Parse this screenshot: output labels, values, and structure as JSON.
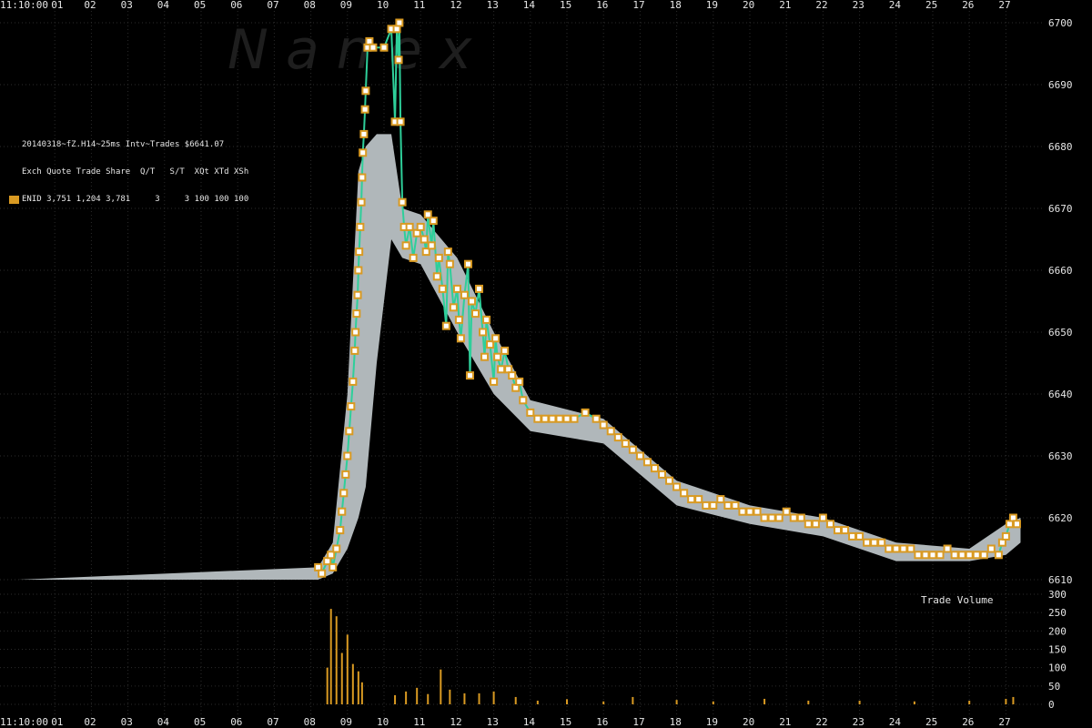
{
  "chart_data": {
    "type": "scatter",
    "watermark": "N a n e x",
    "time_label": "11:10:00",
    "x_ticks": [
      "01",
      "02",
      "03",
      "04",
      "05",
      "06",
      "07",
      "08",
      "09",
      "10",
      "11",
      "12",
      "13",
      "14",
      "15",
      "16",
      "17",
      "18",
      "19",
      "20",
      "21",
      "22",
      "23",
      "24",
      "25",
      "26",
      "27"
    ],
    "x_range_seconds": [
      0,
      28
    ],
    "price_axis": {
      "ticks": [
        "6700",
        "6690",
        "6680",
        "6670",
        "6660",
        "6650",
        "6640",
        "6630",
        "6620",
        "6610"
      ],
      "range": [
        6610,
        6700
      ]
    },
    "volume_axis": {
      "label": "Trade Volume",
      "ticks": [
        "300",
        "250",
        "200",
        "150",
        "100",
        "50",
        "0"
      ],
      "range": [
        0,
        300
      ]
    },
    "info": {
      "title": "20140318~fZ.H14~25ms Intv~Trades $6641.07",
      "header": "Exch Quote Trade Share  Q/T   S/T  XQt XTd XSh",
      "row": "ENID 3,751 1,204 3,781     3     3 100 100 100"
    },
    "colors": {
      "trade": "#d99a22",
      "quote_band": "#b0b7ba",
      "line": "#2ecf9a",
      "volume": "#d99a22"
    },
    "trades": [
      [
        8.2,
        6612
      ],
      [
        8.3,
        6611
      ],
      [
        8.45,
        6613
      ],
      [
        8.55,
        6614
      ],
      [
        8.6,
        6612
      ],
      [
        8.7,
        6615
      ],
      [
        8.8,
        6618
      ],
      [
        8.85,
        6621
      ],
      [
        8.9,
        6624
      ],
      [
        8.95,
        6627
      ],
      [
        9.0,
        6630
      ],
      [
        9.05,
        6634
      ],
      [
        9.1,
        6638
      ],
      [
        9.15,
        6642
      ],
      [
        9.2,
        6647
      ],
      [
        9.22,
        6650
      ],
      [
        9.25,
        6653
      ],
      [
        9.28,
        6656
      ],
      [
        9.3,
        6660
      ],
      [
        9.32,
        6663
      ],
      [
        9.35,
        6667
      ],
      [
        9.38,
        6671
      ],
      [
        9.4,
        6675
      ],
      [
        9.42,
        6679
      ],
      [
        9.45,
        6682
      ],
      [
        9.48,
        6686
      ],
      [
        9.5,
        6689
      ],
      [
        9.55,
        6696
      ],
      [
        9.6,
        6697
      ],
      [
        9.7,
        6696
      ],
      [
        10.0,
        6696
      ],
      [
        10.2,
        6699
      ],
      [
        10.3,
        6684
      ],
      [
        10.35,
        6699
      ],
      [
        10.4,
        6694
      ],
      [
        10.42,
        6700
      ],
      [
        10.45,
        6684
      ],
      [
        10.5,
        6671
      ],
      [
        10.55,
        6667
      ],
      [
        10.6,
        6664
      ],
      [
        10.7,
        6667
      ],
      [
        10.8,
        6662
      ],
      [
        10.9,
        6666
      ],
      [
        11.0,
        6667
      ],
      [
        11.1,
        6665
      ],
      [
        11.15,
        6663
      ],
      [
        11.2,
        6669
      ],
      [
        11.3,
        6664
      ],
      [
        11.35,
        6668
      ],
      [
        11.45,
        6659
      ],
      [
        11.5,
        6662
      ],
      [
        11.6,
        6657
      ],
      [
        11.7,
        6651
      ],
      [
        11.75,
        6663
      ],
      [
        11.8,
        6661
      ],
      [
        11.9,
        6654
      ],
      [
        12.0,
        6657
      ],
      [
        12.05,
        6652
      ],
      [
        12.1,
        6649
      ],
      [
        12.2,
        6656
      ],
      [
        12.3,
        6661
      ],
      [
        12.35,
        6643
      ],
      [
        12.4,
        6655
      ],
      [
        12.5,
        6653
      ],
      [
        12.6,
        6657
      ],
      [
        12.7,
        6650
      ],
      [
        12.75,
        6646
      ],
      [
        12.8,
        6652
      ],
      [
        12.9,
        6648
      ],
      [
        13.0,
        6642
      ],
      [
        13.05,
        6649
      ],
      [
        13.1,
        6646
      ],
      [
        13.2,
        6644
      ],
      [
        13.3,
        6647
      ],
      [
        13.4,
        6644
      ],
      [
        13.5,
        6643
      ],
      [
        13.6,
        6641
      ],
      [
        13.7,
        6642
      ],
      [
        13.8,
        6639
      ],
      [
        14.0,
        6637
      ],
      [
        14.2,
        6636
      ],
      [
        14.4,
        6636
      ],
      [
        14.6,
        6636
      ],
      [
        14.8,
        6636
      ],
      [
        15.0,
        6636
      ],
      [
        15.2,
        6636
      ],
      [
        15.5,
        6637
      ],
      [
        15.8,
        6636
      ],
      [
        16.0,
        6635
      ],
      [
        16.2,
        6634
      ],
      [
        16.4,
        6633
      ],
      [
        16.6,
        6632
      ],
      [
        16.8,
        6631
      ],
      [
        17.0,
        6630
      ],
      [
        17.2,
        6629
      ],
      [
        17.4,
        6628
      ],
      [
        17.6,
        6627
      ],
      [
        17.8,
        6626
      ],
      [
        18.0,
        6625
      ],
      [
        18.2,
        6624
      ],
      [
        18.4,
        6623
      ],
      [
        18.6,
        6623
      ],
      [
        18.8,
        6622
      ],
      [
        19.0,
        6622
      ],
      [
        19.2,
        6623
      ],
      [
        19.4,
        6622
      ],
      [
        19.6,
        6622
      ],
      [
        19.8,
        6621
      ],
      [
        20.0,
        6621
      ],
      [
        20.2,
        6621
      ],
      [
        20.4,
        6620
      ],
      [
        20.6,
        6620
      ],
      [
        20.8,
        6620
      ],
      [
        21.0,
        6621
      ],
      [
        21.2,
        6620
      ],
      [
        21.4,
        6620
      ],
      [
        21.6,
        6619
      ],
      [
        21.8,
        6619
      ],
      [
        22.0,
        6620
      ],
      [
        22.2,
        6619
      ],
      [
        22.4,
        6618
      ],
      [
        22.6,
        6618
      ],
      [
        22.8,
        6617
      ],
      [
        23.0,
        6617
      ],
      [
        23.2,
        6616
      ],
      [
        23.4,
        6616
      ],
      [
        23.6,
        6616
      ],
      [
        23.8,
        6615
      ],
      [
        24.0,
        6615
      ],
      [
        24.2,
        6615
      ],
      [
        24.4,
        6615
      ],
      [
        24.6,
        6614
      ],
      [
        24.8,
        6614
      ],
      [
        25.0,
        6614
      ],
      [
        25.2,
        6614
      ],
      [
        25.4,
        6615
      ],
      [
        25.6,
        6614
      ],
      [
        25.8,
        6614
      ],
      [
        26.0,
        6614
      ],
      [
        26.2,
        6614
      ],
      [
        26.4,
        6614
      ],
      [
        26.6,
        6615
      ],
      [
        26.8,
        6614
      ],
      [
        26.9,
        6616
      ],
      [
        27.0,
        6617
      ],
      [
        27.1,
        6619
      ],
      [
        27.2,
        6620
      ],
      [
        27.3,
        6619
      ]
    ],
    "quote_band": [
      [
        0,
        6610,
        6610
      ],
      [
        8.2,
        6610,
        6612
      ],
      [
        8.6,
        6611,
        6616
      ],
      [
        9.0,
        6615,
        6640
      ],
      [
        9.3,
        6620,
        6676
      ],
      [
        9.5,
        6625,
        6680
      ],
      [
        9.8,
        6645,
        6682
      ],
      [
        10.2,
        6665,
        6682
      ],
      [
        10.5,
        6662,
        6670
      ],
      [
        11.0,
        6661,
        6669
      ],
      [
        12.0,
        6650,
        6662
      ],
      [
        13.0,
        6640,
        6650
      ],
      [
        14.0,
        6634,
        6639
      ],
      [
        16.0,
        6632,
        6636
      ],
      [
        18.0,
        6622,
        6626
      ],
      [
        20.0,
        6619,
        6622
      ],
      [
        22.0,
        6617,
        6620
      ],
      [
        24.0,
        6613,
        6616
      ],
      [
        26.0,
        6613,
        6615
      ],
      [
        27.0,
        6614,
        6619
      ],
      [
        27.4,
        6616,
        6620
      ]
    ],
    "volume": [
      [
        8.45,
        100
      ],
      [
        8.55,
        260
      ],
      [
        8.7,
        240
      ],
      [
        8.85,
        140
      ],
      [
        9.0,
        190
      ],
      [
        9.15,
        110
      ],
      [
        9.3,
        90
      ],
      [
        9.4,
        60
      ],
      [
        10.3,
        25
      ],
      [
        10.6,
        35
      ],
      [
        10.9,
        45
      ],
      [
        11.2,
        28
      ],
      [
        11.55,
        95
      ],
      [
        11.8,
        40
      ],
      [
        12.2,
        30
      ],
      [
        12.6,
        30
      ],
      [
        13.0,
        35
      ],
      [
        13.6,
        20
      ],
      [
        14.2,
        10
      ],
      [
        15.0,
        14
      ],
      [
        16.0,
        8
      ],
      [
        16.8,
        20
      ],
      [
        18.0,
        12
      ],
      [
        19.0,
        8
      ],
      [
        20.4,
        15
      ],
      [
        21.6,
        10
      ],
      [
        23.0,
        10
      ],
      [
        24.5,
        8
      ],
      [
        26.0,
        10
      ],
      [
        27.0,
        15
      ],
      [
        27.2,
        20
      ]
    ]
  }
}
